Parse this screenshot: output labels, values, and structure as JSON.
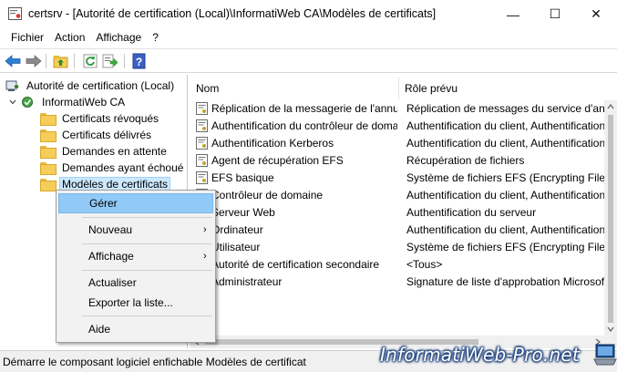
{
  "window": {
    "title": "certsrv - [Autorité de certification (Local)\\InformatiWeb CA\\Modèles de certificats]",
    "minimize_glyph": "—",
    "maximize_glyph": "☐",
    "close_glyph": "✕"
  },
  "menubar": [
    "Fichier",
    "Action",
    "Affichage",
    "?"
  ],
  "toolbar": {
    "icons": [
      "back-arrow-icon",
      "forward-arrow-icon",
      "up-folder-icon",
      "refresh-icon",
      "export-list-icon",
      "help-icon"
    ]
  },
  "tree": {
    "root": "Autorité de certification (Local)",
    "ca": "InformatiWeb CA",
    "folders": [
      "Certificats révoqués",
      "Certificats délivrés",
      "Demandes en attente",
      "Demandes ayant échoué",
      "Modèles de certificats"
    ],
    "selected_index": 4
  },
  "list": {
    "columns": [
      "Nom",
      "Rôle prévu"
    ],
    "rows": [
      {
        "name": "Réplication de la messagerie de l'annuaire",
        "role": "Réplication de messages du service d'annuaire"
      },
      {
        "name": "Authentification du contrôleur de domaine",
        "role": "Authentification du client, Authentification du serveur"
      },
      {
        "name": "Authentification Kerberos",
        "role": "Authentification du client, Authentification du serveur"
      },
      {
        "name": "Agent de récupération EFS",
        "role": "Récupération de fichiers"
      },
      {
        "name": "EFS basique",
        "role": "Système de fichiers EFS (Encrypting File System)"
      },
      {
        "name": "Contrôleur de domaine",
        "role": "Authentification du client, Authentification du serveur"
      },
      {
        "name": "Serveur Web",
        "role": "Authentification du serveur"
      },
      {
        "name": "Ordinateur",
        "role": "Authentification du client, Authentification du serveur"
      },
      {
        "name": "Utilisateur",
        "role": "Système de fichiers EFS (Encrypting File System)"
      },
      {
        "name": "Autorité de certification secondaire",
        "role": "<Tous>"
      },
      {
        "name": "Administrateur",
        "role": "Signature de liste d'approbation Microsoft"
      }
    ]
  },
  "context_menu": {
    "items": [
      {
        "label": "Gérer",
        "submenu": false,
        "highlighted": true
      },
      {
        "label": "Nouveau",
        "submenu": true,
        "highlighted": false
      },
      {
        "label": "Affichage",
        "submenu": true,
        "highlighted": false
      },
      {
        "label": "Actualiser",
        "submenu": false,
        "highlighted": false
      },
      {
        "label": "Exporter la liste...",
        "submenu": false,
        "highlighted": false
      },
      {
        "label": "Aide",
        "submenu": false,
        "highlighted": false
      }
    ],
    "arrow_glyph": "›"
  },
  "statusbar": {
    "text": "Démarre le composant logiciel enfichable Modèles de certificat"
  },
  "watermark": {
    "text": "InformatiWeb-Pro.net"
  },
  "colors": {
    "selection": "#cce8ff",
    "menu_highlight": "#91c9f7",
    "folder": "#f5cd58"
  }
}
